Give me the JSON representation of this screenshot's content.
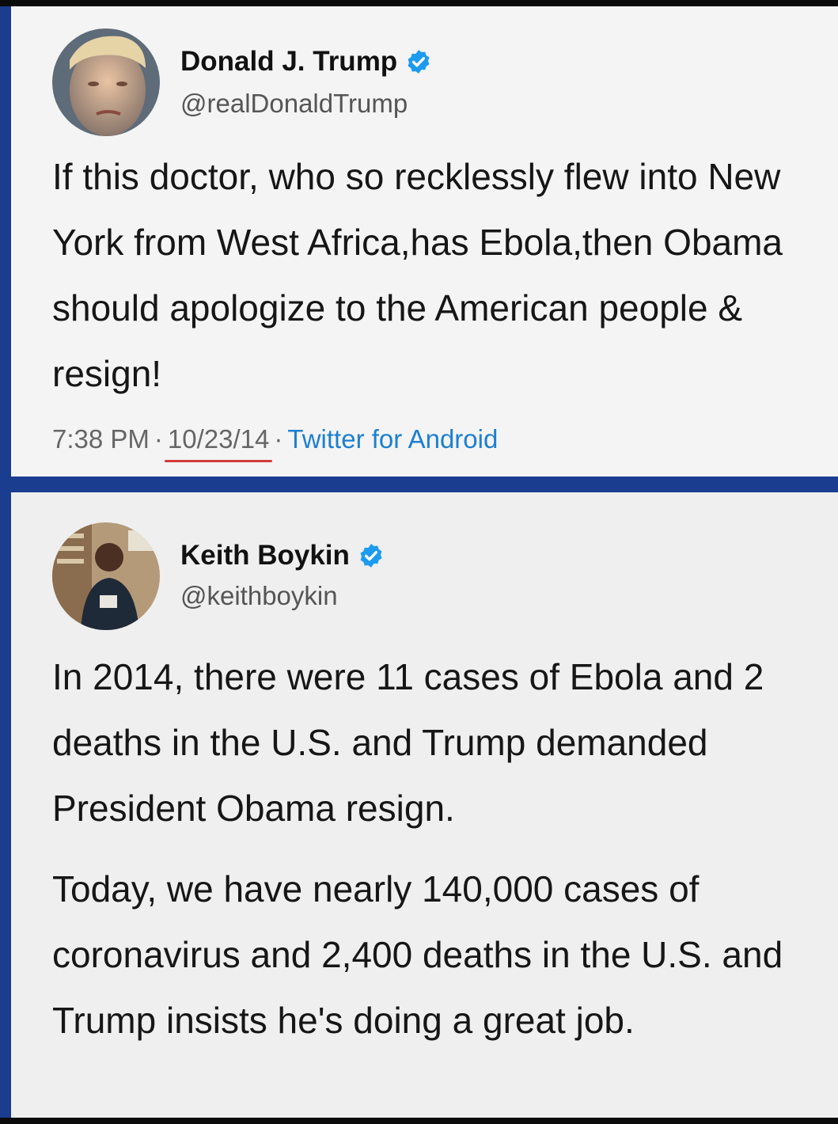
{
  "tweets": [
    {
      "author": {
        "name": "Donald J. Trump",
        "handle": "@realDonaldTrump",
        "verified": true
      },
      "text": "If this doctor, who so recklessly flew into New York from West Africa,has Ebola,then Obama should apologize to the American people & resign!",
      "time": "7:38 PM",
      "separator": "·",
      "date": "10/23/14",
      "client": "Twitter for Android"
    },
    {
      "author": {
        "name": "Keith Boykin",
        "handle": "@keithboykin",
        "verified": true
      },
      "paragraphs": [
        "In 2014, there were 11 cases of Ebola and 2 deaths in the U.S. and Trump demanded President Obama resign.",
        "Today, we have nearly 140,000 cases of coronavirus and 2,400 deaths in the U.S. and Trump insists he's doing a great job."
      ]
    }
  ],
  "colors": {
    "frame": "#1a3d8f",
    "panel": "#f4f4f4",
    "verified": "#1d9bf0",
    "client_link": "#1d7fcf",
    "date_underline": "#d23b3b"
  },
  "icons": {
    "verified": "verified-badge-icon"
  }
}
